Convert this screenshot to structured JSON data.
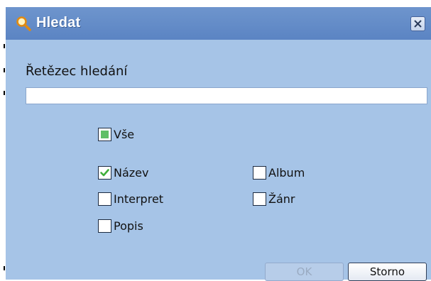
{
  "dialog": {
    "title": "Hledat",
    "title_icon": "magnifier-icon",
    "close_icon": "close-icon"
  },
  "search": {
    "label": "Řetězec hledání",
    "value": "",
    "placeholder": ""
  },
  "checkboxes": {
    "all": {
      "label": "Vše",
      "state": "indeterminate"
    },
    "name": {
      "label": "Název",
      "checked": true
    },
    "album": {
      "label": "Album",
      "checked": false
    },
    "artist": {
      "label": "Interpret",
      "checked": false
    },
    "genre": {
      "label": "Žánr",
      "checked": false
    },
    "description": {
      "label": "Popis",
      "checked": false
    }
  },
  "buttons": {
    "ok": {
      "label": "OK",
      "enabled": false
    },
    "cancel": {
      "label": "Storno",
      "enabled": true
    }
  },
  "colors": {
    "dialog_body": "#a6c4e7",
    "titlebar": "#5b84c3",
    "checkmark": "#3fae3a",
    "indeterminate_fill": "#5fbf67"
  }
}
